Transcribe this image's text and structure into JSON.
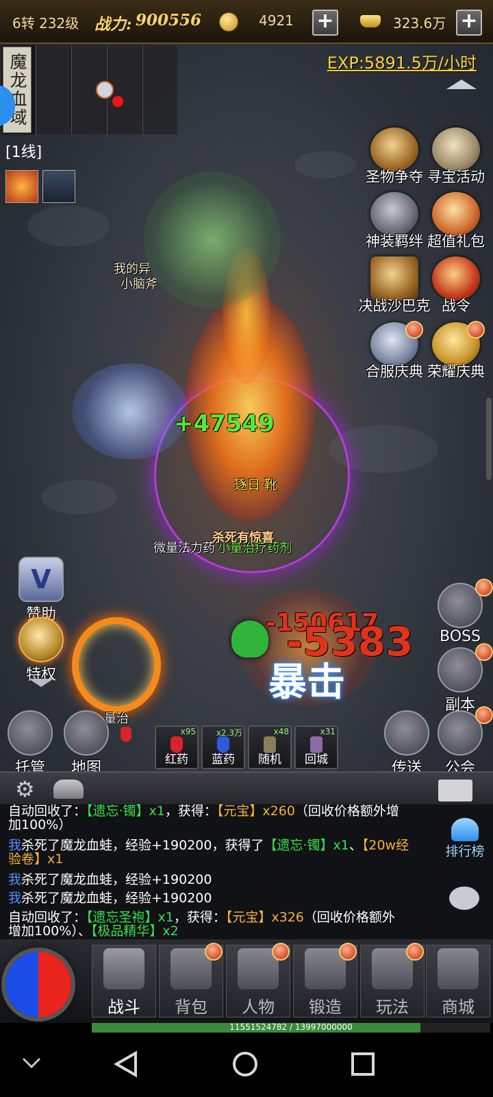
{
  "top_bar": {
    "level": "6转 232级",
    "power_label": "战力:",
    "power_value": "900556",
    "coins": "4921",
    "ingots": "323.6万",
    "plus": "+"
  },
  "minimap": {
    "map_name": "魔龙血域",
    "line": "[1线]"
  },
  "exp_rate": "EXP:5891.5万/小时",
  "activities": [
    {
      "label": "圣物争夺",
      "dot": false
    },
    {
      "label": "寻宝活动",
      "dot": false
    },
    {
      "label": "神装羁绊",
      "dot": false
    },
    {
      "label": "超值礼包",
      "dot": false
    },
    {
      "label": "决战沙巴克",
      "dot": false
    },
    {
      "label": "战令",
      "dot": false
    },
    {
      "label": "合服庆典",
      "dot": true
    },
    {
      "label": "荣耀庆典",
      "dot": true
    }
  ],
  "battle": {
    "pet_name_1": "我的异",
    "pet_name_2": "小脑斧",
    "heal": "+47549",
    "buff_name": "逐日·靴",
    "drop_1": "微量法力药",
    "drop_2": "小量治疗药剂",
    "banner": "杀死有惊喜",
    "damage_1": "-150617",
    "damage_2": "-5383",
    "crit": "暴击",
    "partial_text": "量治"
  },
  "left_buttons": {
    "sponsor": "赞助",
    "privilege": "特权",
    "sponsor_icon_letter": "V"
  },
  "right_buttons": {
    "boss": "BOSS",
    "dungeon": "副本",
    "guild": "公会",
    "teleport": "传送"
  },
  "bottom_left": {
    "auto": "托管",
    "map": "地图"
  },
  "slots": [
    {
      "name": "红药",
      "count": "x95",
      "color": "#d8232a"
    },
    {
      "name": "蓝药",
      "count": "x2.3万",
      "color": "#2b5bd8"
    },
    {
      "name": "随机",
      "count": "x48",
      "color": "#8a7d5a"
    },
    {
      "name": "回城",
      "count": "x31",
      "color": "#8a6aa8"
    }
  ],
  "chat": {
    "ranking": "排行榜",
    "lines": [
      {
        "segments": [
          {
            "t": "自动回收了：",
            "c": "w"
          },
          {
            "t": "【遗忘·镯】x1",
            "c": "g"
          },
          {
            "t": "，获得：",
            "c": "w"
          },
          {
            "t": "【元宝】x260",
            "c": "y"
          },
          {
            "t": "（回收价格额外增",
            "c": "w"
          }
        ]
      },
      {
        "segments": [
          {
            "t": "加100%）",
            "c": "w"
          }
        ]
      },
      {
        "segments": [
          {
            "t": "我",
            "c": "b"
          },
          {
            "t": "杀死了魔龙血蛙，经验+190200，获得了",
            "c": "w"
          },
          {
            "t": "【遗忘·镯】x1",
            "c": "g"
          },
          {
            "t": "、",
            "c": "w"
          },
          {
            "t": "【20w经",
            "c": "y"
          }
        ]
      },
      {
        "segments": [
          {
            "t": "验卷】x1",
            "c": "y"
          }
        ]
      },
      {
        "segments": [
          {
            "t": "我",
            "c": "b"
          },
          {
            "t": "杀死了魔龙血蛙，经验+190200",
            "c": "w"
          }
        ]
      },
      {
        "segments": [
          {
            "t": "我",
            "c": "b"
          },
          {
            "t": "杀死了魔龙血蛙，经验+190200",
            "c": "w"
          }
        ]
      },
      {
        "segments": [
          {
            "t": "自动回收了：",
            "c": "w"
          },
          {
            "t": "【遗忘圣袍】x1",
            "c": "g"
          },
          {
            "t": "，获得：",
            "c": "w"
          },
          {
            "t": "【元宝】x326",
            "c": "y"
          },
          {
            "t": "（回收价格额外",
            "c": "w"
          }
        ]
      },
      {
        "segments": [
          {
            "t": "增加100%）、",
            "c": "w"
          },
          {
            "t": "【极品精华】x2",
            "c": "g"
          }
        ]
      }
    ]
  },
  "nav": [
    {
      "label": "战斗",
      "active": true
    },
    {
      "label": "背包",
      "dot": true
    },
    {
      "label": "人物",
      "dot": true
    },
    {
      "label": "锻造",
      "dot": true
    },
    {
      "label": "玩法",
      "dot": true
    },
    {
      "label": "商城",
      "dot": false
    }
  ],
  "exp_bar": {
    "text": "11551524782 / 13997000000",
    "fraction": 0.8253
  }
}
